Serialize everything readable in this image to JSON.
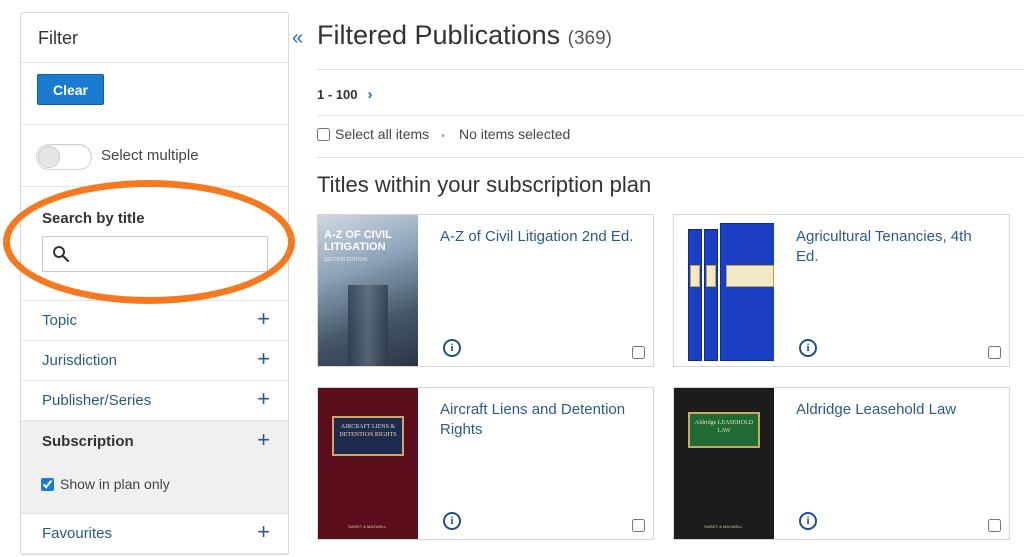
{
  "filter": {
    "title": "Filter",
    "clear_label": "Clear",
    "select_multiple_label": "Select multiple",
    "search_label": "Search by title",
    "search_value": "",
    "search_placeholder": "",
    "facets": [
      {
        "label": "Topic"
      },
      {
        "label": "Jurisdiction"
      },
      {
        "label": "Publisher/Series"
      }
    ],
    "subscription": {
      "label": "Subscription",
      "show_in_plan_label": "Show in plan only",
      "show_in_plan_checked": true
    },
    "favourites_label": "Favourites",
    "plus_glyph": "+"
  },
  "main": {
    "collapse_glyph": "«",
    "title": "Filtered Publications",
    "count": "(369)",
    "pager_range": "1 - 100",
    "pager_next_glyph": "›",
    "select_all_label": "Select all items",
    "selection_status": "No items selected",
    "section_title": "Titles within your subscription plan",
    "info_glyph": "i",
    "cards": [
      {
        "title": "A-Z of Civil Litigation 2nd Ed.",
        "cover": {
          "title": "A-Z OF CIVIL LITIGATION",
          "subtitle": "SECOND EDITION"
        }
      },
      {
        "title": "Agricultural Tenancies, 4th Ed."
      },
      {
        "title": "Aircraft Liens and Detention Rights",
        "cover": {
          "title": "AIRCRAFT LIENS & DETENTION RIGHTS",
          "publisher": "SWEET & MAXWELL"
        }
      },
      {
        "title": "Aldridge Leasehold Law",
        "cover": {
          "title": "Aldridge LEASEHOLD LAW",
          "publisher": "SWEET & MAXWELL"
        }
      }
    ]
  },
  "colors": {
    "accent": "#1a7bd1",
    "link": "#2a5a8c",
    "highlight": "#f7791f"
  }
}
